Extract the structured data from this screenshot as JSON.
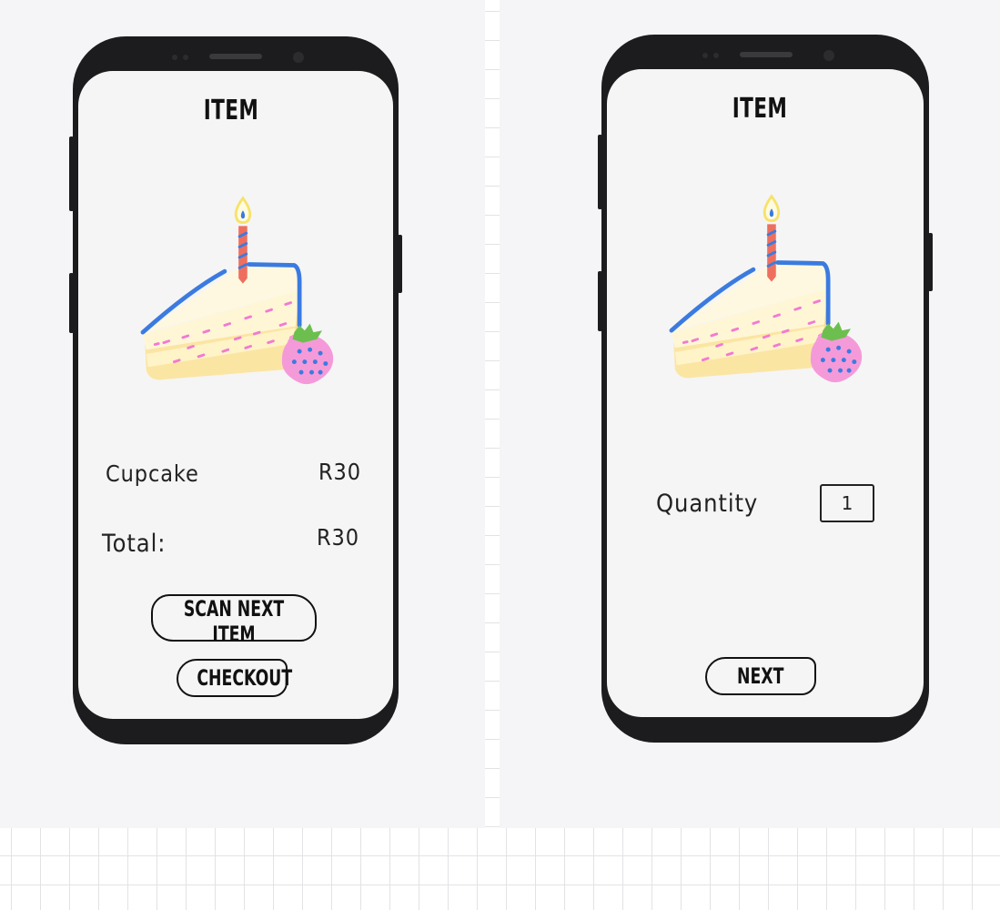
{
  "screens": {
    "item_screen": {
      "title": "ITEM",
      "image": "cake-slice-with-candle-and-strawberry",
      "item_name": "Cupcake",
      "item_price": "R30",
      "total_label": "Total:",
      "total_value": "R30",
      "scan_next_label": "SCAN NEXT ITEM",
      "checkout_label": "CHECKOUT"
    },
    "quantity_screen": {
      "title": "ITEM",
      "image": "cake-slice-with-candle-and-strawberry",
      "quantity_label": "Quantity",
      "quantity_value": "1",
      "next_label": "NEXT"
    }
  },
  "colors": {
    "board": "#f5f5f7",
    "phone_body": "#1c1c1e",
    "screen": "#f5f5f5",
    "cake_cream": "#fff6d6",
    "cake_sponge": "#fbe5a3",
    "cake_outline": "#3b7be0",
    "candle": "#ef6f5f",
    "flame": "#f7e26b",
    "strawberry": "#f59ad9",
    "leaf": "#6cbf4f",
    "sprinkles": "#f27ad2"
  }
}
